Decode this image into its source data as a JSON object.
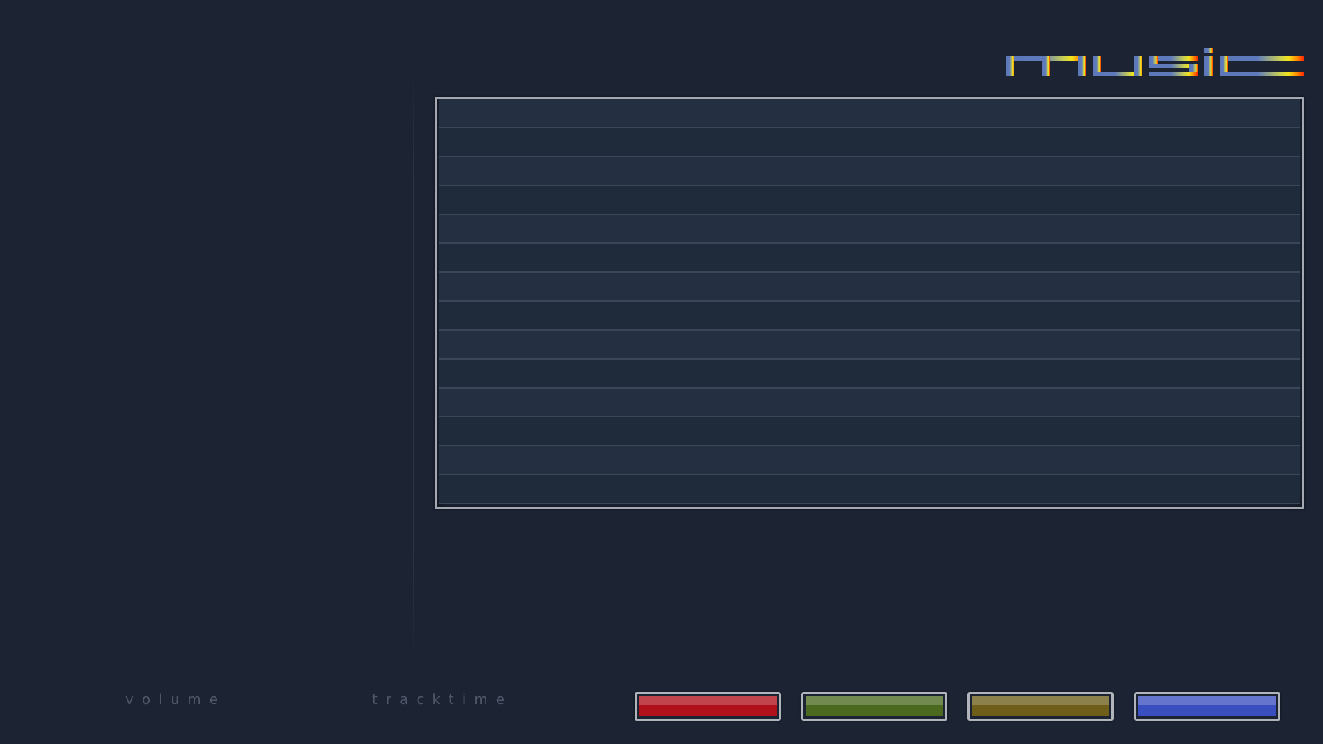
{
  "header": {
    "logo_text": "music",
    "logo_gradient": [
      "#5b77b7",
      "#5f7bbd",
      "#d6d64a",
      "#ffe21a",
      "#ff6a00",
      "#ff2a00"
    ]
  },
  "track_list": {
    "rows": [
      "",
      "",
      "",
      "",
      "",
      "",
      "",
      "",
      "",
      "",
      "",
      "",
      "",
      ""
    ]
  },
  "footer": {
    "volume_label": "volume",
    "tracktime_label": "tracktime"
  },
  "color_buttons": [
    {
      "name": "red",
      "color": "#b0101a"
    },
    {
      "name": "green",
      "color": "#4b6a1f"
    },
    {
      "name": "yellow",
      "color": "#6e5e19"
    },
    {
      "name": "blue",
      "color": "#3a4fbf"
    }
  ]
}
